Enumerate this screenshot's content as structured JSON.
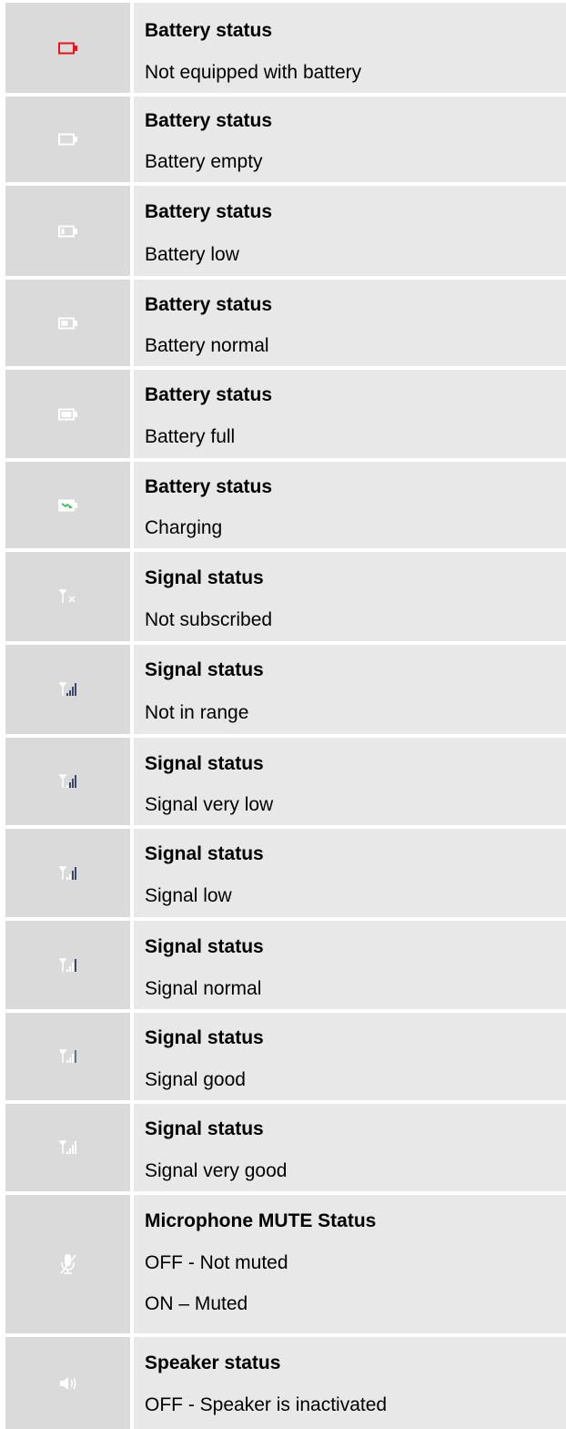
{
  "rows": [
    {
      "icon": "battery-not-equipped-icon",
      "title": "Battery status",
      "lines": [
        "Not equipped with battery"
      ]
    },
    {
      "icon": "battery-empty-icon",
      "title": "Battery status",
      "lines": [
        "Battery empty"
      ]
    },
    {
      "icon": "battery-low-icon",
      "title": "Battery status",
      "lines": [
        "Battery low"
      ]
    },
    {
      "icon": "battery-normal-icon",
      "title": "Battery status",
      "lines": [
        "Battery normal"
      ]
    },
    {
      "icon": "battery-full-icon",
      "title": "Battery status",
      "lines": [
        "Battery full"
      ]
    },
    {
      "icon": "battery-charging-icon",
      "title": "Battery status",
      "lines": [
        "Charging"
      ]
    },
    {
      "icon": "signal-not-subscribed-icon",
      "title": "Signal status",
      "lines": [
        "Not subscribed"
      ]
    },
    {
      "icon": "signal-not-in-range-icon",
      "title": "Signal status",
      "lines": [
        "Not in range"
      ]
    },
    {
      "icon": "signal-very-low-icon",
      "title": "Signal status",
      "lines": [
        "Signal very low"
      ]
    },
    {
      "icon": "signal-low-icon",
      "title": "Signal status",
      "lines": [
        "Signal low"
      ]
    },
    {
      "icon": "signal-normal-icon",
      "title": "Signal status",
      "lines": [
        "Signal normal"
      ]
    },
    {
      "icon": "signal-good-icon",
      "title": "Signal status",
      "lines": [
        "Signal good"
      ]
    },
    {
      "icon": "signal-very-good-icon",
      "title": "Signal status",
      "lines": [
        "Signal very good"
      ]
    },
    {
      "icon": "microphone-mute-icon",
      "title": "Microphone MUTE Status",
      "lines": [
        "OFF - Not muted",
        "ON – Muted"
      ]
    },
    {
      "icon": "speaker-icon",
      "title": "Speaker status",
      "lines": [
        "OFF - Speaker is inactivated"
      ]
    }
  ],
  "colors": {
    "icon_cell_bg": "#dadada",
    "text_cell_bg": "#e8e8e8",
    "battery_not_equipped": "#e8141c",
    "charging_bolt": "#22c040",
    "signal_bars": "#3c4668",
    "icon_white": "#ffffff"
  }
}
